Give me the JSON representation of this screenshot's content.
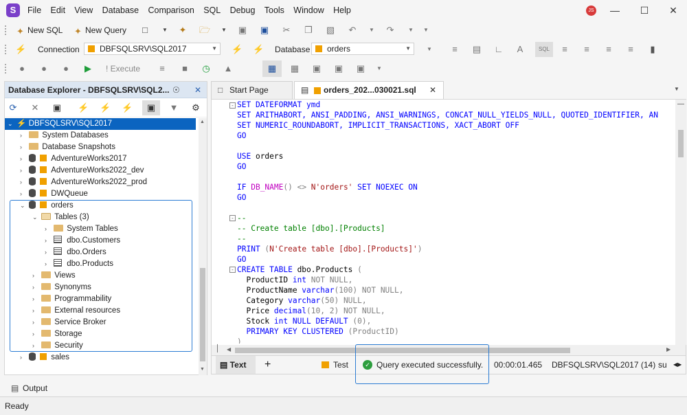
{
  "menubar": {
    "logo": "S",
    "items": [
      "File",
      "Edit",
      "View",
      "Database",
      "Comparison",
      "SQL",
      "Debug",
      "Tools",
      "Window",
      "Help"
    ],
    "user_initials": "JS"
  },
  "toolbar1": {
    "new_sql": "New SQL",
    "new_query": "New Query"
  },
  "toolbar2": {
    "connection_label": "Connection",
    "connection_value": "DBFSQLSRV\\SQL2017",
    "database_label": "Database",
    "database_value": "orders"
  },
  "toolbar3": {
    "execute": "Execute"
  },
  "explorer": {
    "title": "Database Explorer - DBFSQLSRV\\SQL2...",
    "tree": {
      "server": "DBFSQLSRV\\SQL2017",
      "system_databases": "System Databases",
      "database_snapshots": "Database Snapshots",
      "db_aw2017": "AdventureWorks2017",
      "db_aw2022dev": "AdventureWorks2022_dev",
      "db_aw2022prod": "AdventureWorks2022_prod",
      "db_dwqueue": "DWQueue",
      "db_orders": "orders",
      "tables": "Tables (3)",
      "system_tables": "System Tables",
      "customers": "dbo.Customers",
      "orders_tbl": "dbo.Orders",
      "products": "dbo.Products",
      "views": "Views",
      "synonyms": "Synonyms",
      "programmability": "Programmability",
      "external_resources": "External resources",
      "service_broker": "Service Broker",
      "storage": "Storage",
      "security": "Security",
      "db_sales": "sales"
    }
  },
  "tabs": {
    "start_page": "Start Page",
    "file": "orders_202...030021.sql"
  },
  "code": {
    "l1": "SET DATEFORMAT ymd",
    "l2a": "SET ARITHABORT, ANSI_PADDING, ANSI_WARNINGS, CONCAT_NULL_YIELDS_NULL, QUOTED_IDENTIFIER, AN",
    "l3": "SET NUMERIC_ROUNDABORT, IMPLICIT_TRANSACTIONS, XACT_ABORT OFF",
    "go": "GO",
    "use_kw": "USE",
    "use_db": " orders",
    "if_kw": "IF ",
    "db_name_fn": "DB_NAME",
    "if_mid": "() <> ",
    "if_str": "N'orders'",
    "if_end": " SET NOEXEC ON",
    "c_dash": "--",
    "c_create": "-- Create table [dbo].[Products]",
    "print_kw": "PRINT",
    "print_open": " (",
    "print_str": "N'Create table [dbo].[Products]'",
    "print_close": ")",
    "create_kw": "CREATE TABLE",
    "create_name": " dbo.Products ",
    "paren_open": "(",
    "c1": "  ProductID ",
    "c1t": "int",
    "c1n": " NOT NULL",
    "c2": "  ProductName ",
    "c2t": "varchar",
    "c2a": "(100) ",
    "c2n": "NOT NULL",
    "c3": "  Category ",
    "c3t": "varchar",
    "c3a": "(50) ",
    "c3n": "NULL",
    "c4": "  Price ",
    "c4t": "decimal",
    "c4a": "(10, 2) ",
    "c4n": "NOT NULL",
    "c5": "  Stock ",
    "c5t": "int",
    "c5n": " NULL DEFAULT ",
    "c5d": "(0)",
    "c6kw": "  PRIMARY KEY CLUSTERED ",
    "c6": "(ProductID)",
    "close": ")",
    "comma": ","
  },
  "results": {
    "text_tab": "Text",
    "add": "+",
    "test": "Test",
    "message": "Query executed successfully.",
    "elapsed": "00:00:01.465",
    "server": "DBFSQLSRV\\SQL2017 (14)",
    "user": "su"
  },
  "output": {
    "label": "Output"
  },
  "status": {
    "text": "Ready"
  }
}
